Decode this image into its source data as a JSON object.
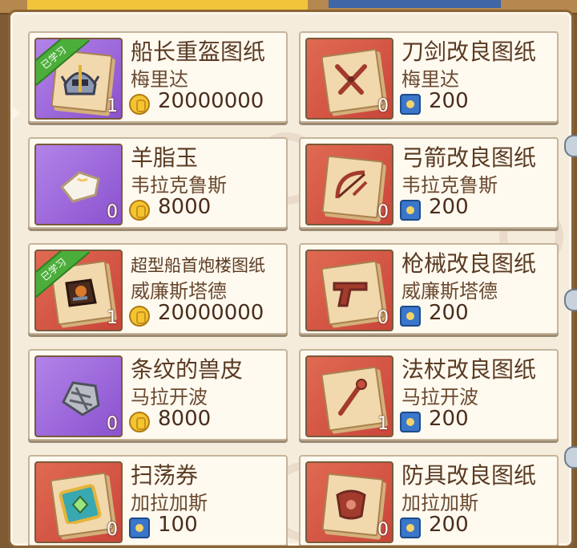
{
  "learned_label": "已学习",
  "colors": {
    "card_red": "#d7533f",
    "card_purple": "#9e68dc",
    "ribbon_green": "#4cae3a",
    "text_brown": "#5a3a22"
  },
  "items": [
    {
      "name": "船长重盔图纸",
      "seller": "梅里达",
      "price": "20000000",
      "currency": "gold-coin",
      "count": "1",
      "learned": true,
      "thumb": "purple",
      "icon": "helmet-blueprint-icon"
    },
    {
      "name": "刀剑改良图纸",
      "seller": "梅里达",
      "price": "200",
      "currency": "blue-token",
      "count": "0",
      "learned": false,
      "thumb": "red",
      "icon": "sword-blueprint-icon"
    },
    {
      "name": "羊脂玉",
      "seller": "韦拉克鲁斯",
      "price": "8000",
      "currency": "gold-coin",
      "count": "0",
      "learned": false,
      "thumb": "purple",
      "icon": "jade-icon"
    },
    {
      "name": "弓箭改良图纸",
      "seller": "韦拉克鲁斯",
      "price": "200",
      "currency": "blue-token",
      "count": "0",
      "learned": false,
      "thumb": "red",
      "icon": "bow-blueprint-icon"
    },
    {
      "name": "超型船首炮楼图纸",
      "seller": "威廉斯塔德",
      "price": "20000000",
      "currency": "gold-coin",
      "count": "1",
      "learned": true,
      "thumb": "red",
      "icon": "cannon-tower-blueprint-icon"
    },
    {
      "name": "枪械改良图纸",
      "seller": "威廉斯塔德",
      "price": "200",
      "currency": "blue-token",
      "count": "0",
      "learned": false,
      "thumb": "red",
      "icon": "gun-blueprint-icon"
    },
    {
      "name": "条纹的兽皮",
      "seller": "马拉开波",
      "price": "8000",
      "currency": "gold-coin",
      "count": "0",
      "learned": false,
      "thumb": "purple",
      "icon": "striped-hide-icon"
    },
    {
      "name": "法杖改良图纸",
      "seller": "马拉开波",
      "price": "200",
      "currency": "blue-token",
      "count": "1",
      "learned": false,
      "thumb": "red",
      "icon": "staff-blueprint-icon"
    },
    {
      "name": "扫荡券",
      "seller": "加拉加斯",
      "price": "100",
      "currency": "blue-token",
      "count": "0",
      "learned": false,
      "thumb": "red",
      "icon": "sweep-ticket-icon"
    },
    {
      "name": "防具改良图纸",
      "seller": "加拉加斯",
      "price": "200",
      "currency": "blue-token",
      "count": "0",
      "learned": false,
      "thumb": "red",
      "icon": "armor-blueprint-icon"
    }
  ]
}
